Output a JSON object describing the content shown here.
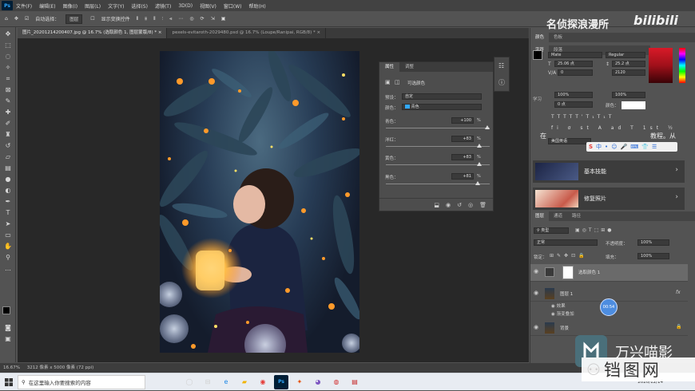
{
  "app": {
    "logo": "Ps",
    "menus": [
      "文件(F)",
      "编辑(E)",
      "图像(I)",
      "图层(L)",
      "文字(Y)",
      "选择(S)",
      "滤镜(T)",
      "3D(D)",
      "视图(V)",
      "窗口(W)",
      "帮助(H)"
    ]
  },
  "options_bar": {
    "auto_select_label": "自动选择：",
    "auto_select_value": "图层",
    "show_transform_label": "显示变换控件"
  },
  "doc_tabs": [
    {
      "label": "图片_20201214200407.jpg @ 16.7% (选取颜色 1, 图层蒙版/8) *",
      "active": true
    },
    {
      "label": "pexels-evitaroth-2029480.psd @ 16.7% (Loupe/Ranipai, RGB/8) *",
      "active": false
    }
  ],
  "properties_panel": {
    "tabs": [
      "属性",
      "调整"
    ],
    "title": "可选颜色",
    "preset_label": "预设：",
    "preset_value": "自定",
    "colors_label": "颜色：",
    "colors_value": "青色",
    "rows": [
      {
        "label": "青色：",
        "value": "+100",
        "unit": "%",
        "level": 1.0
      },
      {
        "label": "洋红：",
        "value": "+83",
        "unit": "%",
        "level": 0.92
      },
      {
        "label": "黄色：",
        "value": "+83",
        "unit": "%",
        "level": 0.92
      },
      {
        "label": "黑色：",
        "value": "+81",
        "unit": "%",
        "level": 0.9
      }
    ]
  },
  "right_panel": {
    "top_tabs": [
      "颜色",
      "色板"
    ],
    "char_tabs": [
      "字符",
      "段落"
    ],
    "font_family": "Mate",
    "font_style": "Regular",
    "font_size": "25.06 点",
    "leading": "25.2 点",
    "kerning": "0",
    "tracking": "2120",
    "vscale": "100%",
    "hscale": "100%",
    "baseline": "0 点",
    "color_label": "颜色：",
    "language": "美国英语",
    "learn_tab": "学习",
    "learn_hint_left": "在",
    "learn_hint_right": "教程。从",
    "learn_items": [
      {
        "label": "基本技能"
      },
      {
        "label": "修复照片"
      }
    ],
    "layers_tabs": [
      "图层",
      "通道",
      "路径"
    ],
    "layer_filter": "类型",
    "blend_mode": "正常",
    "opacity_label": "不透明度：",
    "opacity": "100%",
    "lock_label": "锁定：",
    "fill_label": "填充：",
    "fill": "100%",
    "layers": [
      {
        "name": "选取颜色 1",
        "selected": true
      },
      {
        "name": "图层 1",
        "selected": false
      },
      {
        "name": "效果",
        "selected": false
      },
      {
        "name": "渐变叠加",
        "selected": false
      },
      {
        "name": "背景",
        "selected": false
      }
    ],
    "fx_label": "fx"
  },
  "statusbar": {
    "zoom": "16.67%",
    "doc_info": "3212 像素 x 5000 像素 (72 ppi)"
  },
  "taskbar": {
    "search_placeholder": "在这里输入你要搜索的内容",
    "clock": "2020/12/14"
  },
  "watermarks": {
    "channel": "名侦探浪漫所",
    "bilibili": "bilibili",
    "wanxing": "万兴喵影",
    "site": "铛图网",
    "badge": "00:54"
  },
  "colors": {
    "accent": "#31a8ff",
    "fg_swatch": "#000000",
    "bg_swatch": "#ffffff",
    "picker_red": "#a0101a"
  }
}
